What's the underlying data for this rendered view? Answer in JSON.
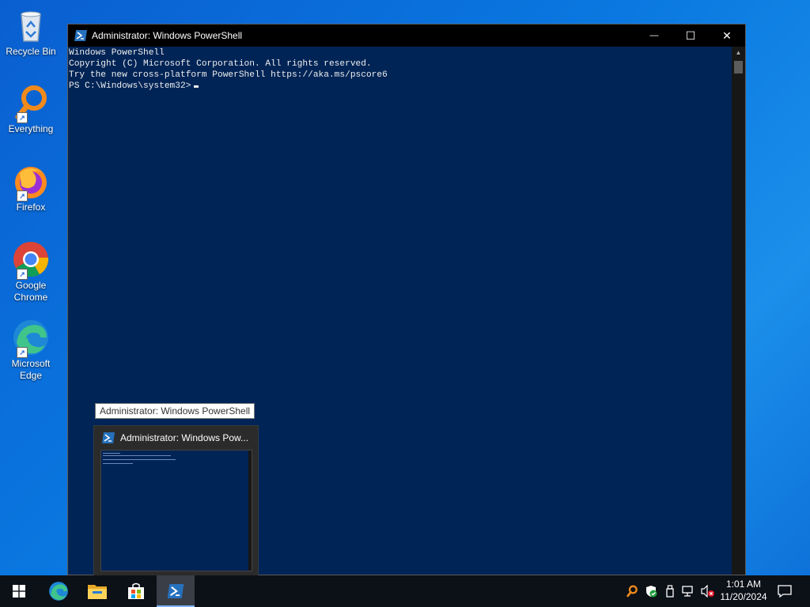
{
  "desktop": {
    "icons": [
      {
        "label": "Recycle Bin",
        "icon": "recycle-bin-icon"
      },
      {
        "label": "Everything",
        "icon": "everything-search-icon"
      },
      {
        "label": "Firefox",
        "icon": "firefox-icon"
      },
      {
        "label": "Google Chrome",
        "icon": "chrome-icon"
      },
      {
        "label": "Microsoft Edge",
        "icon": "edge-icon"
      }
    ]
  },
  "window": {
    "title": "Administrator: Windows PowerShell",
    "minimize_glyph": "—",
    "maximize_glyph": "☐",
    "close_glyph": "✕",
    "console_lines": [
      "Windows PowerShell",
      "Copyright (C) Microsoft Corporation. All rights reserved.",
      "",
      "Try the new cross-platform PowerShell https://aka.ms/pscore6",
      "",
      "PS C:\\Windows\\system32>"
    ],
    "background": "#012456"
  },
  "tooltip": {
    "text": "Administrator: Windows PowerShell"
  },
  "preview": {
    "title": "Administrator: Windows Pow..."
  },
  "taskbar": {
    "items": [
      "start-icon",
      "edge-icon",
      "file-explorer-icon",
      "microsoft-store-icon",
      "powershell-icon"
    ],
    "tray_icons": [
      "everything-search-icon",
      "security-shield-icon",
      "usb-device-icon",
      "network-icon",
      "volume-muted-icon",
      "notification-icon"
    ],
    "time": "1:01 AM",
    "date": "11/20/2024"
  }
}
